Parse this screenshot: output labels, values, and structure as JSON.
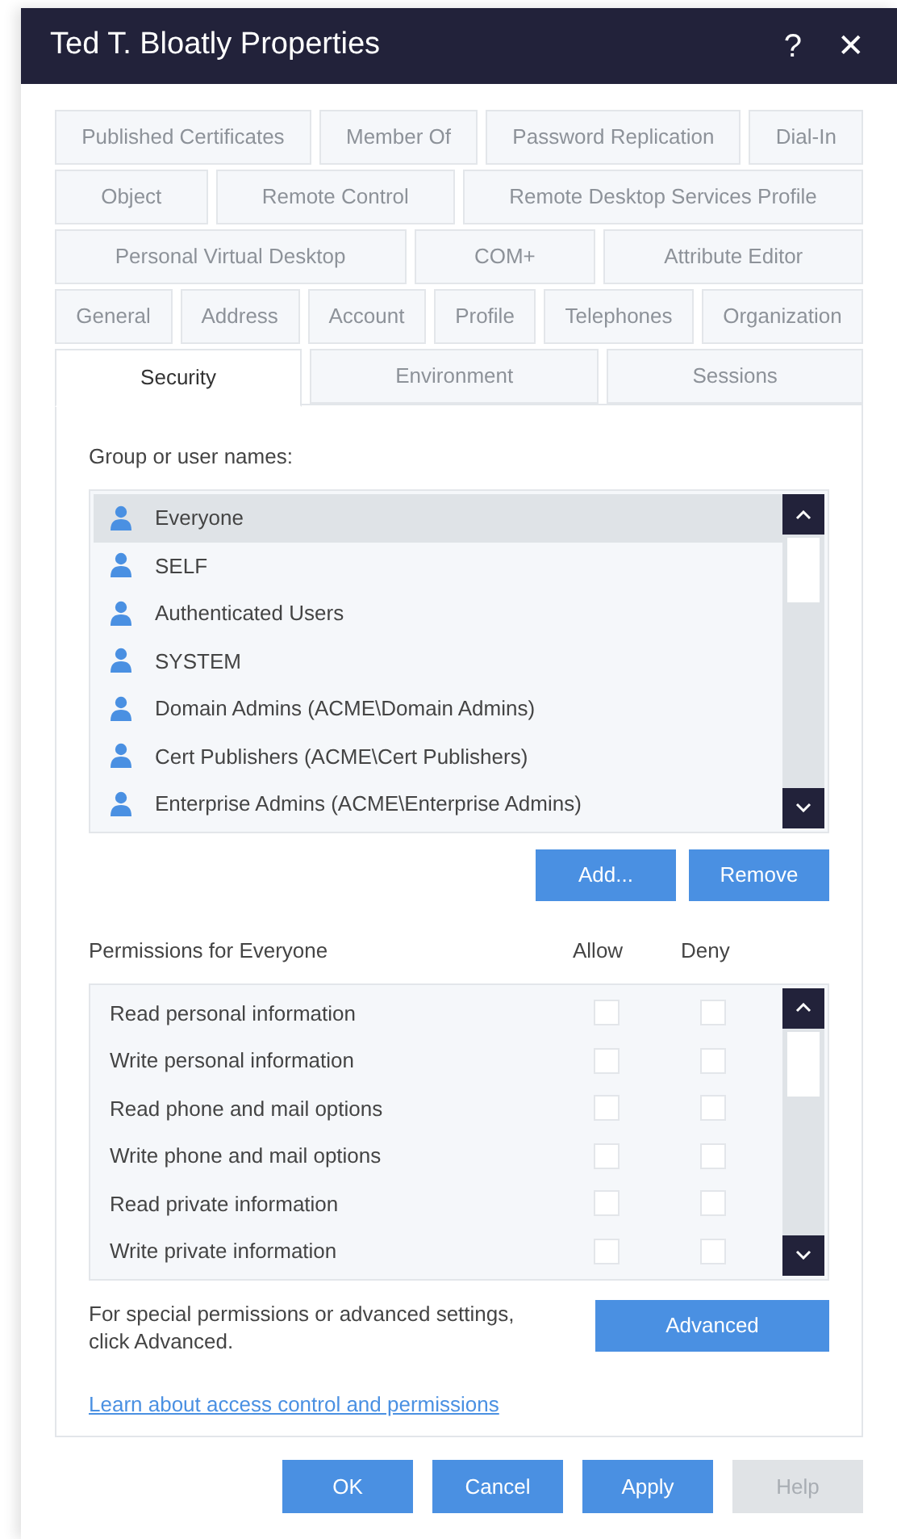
{
  "window": {
    "title": "Ted T. Bloatly Properties",
    "help_glyph": "?",
    "close_glyph": "✕"
  },
  "tab_rows": [
    [
      {
        "label": "Published Certificates",
        "selected": false
      },
      {
        "label": "Member Of",
        "selected": false
      },
      {
        "label": "Password Replication",
        "selected": false
      },
      {
        "label": "Dial-In",
        "selected": false
      }
    ],
    [
      {
        "label": "Object",
        "selected": false
      },
      {
        "label": "Remote Control",
        "selected": false
      },
      {
        "label": "Remote Desktop Services Profile",
        "selected": false
      }
    ],
    [
      {
        "label": "Personal Virtual Desktop",
        "selected": false
      },
      {
        "label": "COM+",
        "selected": false
      },
      {
        "label": "Attribute Editor",
        "selected": false
      }
    ],
    [
      {
        "label": "General",
        "selected": false
      },
      {
        "label": "Address",
        "selected": false
      },
      {
        "label": "Account",
        "selected": false
      },
      {
        "label": "Profile",
        "selected": false
      },
      {
        "label": "Telephones",
        "selected": false
      },
      {
        "label": "Organization",
        "selected": false
      }
    ],
    [
      {
        "label": "Security",
        "selected": true
      },
      {
        "label": "Environment",
        "selected": false
      },
      {
        "label": "Sessions",
        "selected": false
      }
    ]
  ],
  "group_label": "Group or user names:",
  "users": [
    {
      "name": "Everyone",
      "selected": true
    },
    {
      "name": "SELF",
      "selected": false
    },
    {
      "name": "Authenticated Users",
      "selected": false
    },
    {
      "name": "SYSTEM",
      "selected": false
    },
    {
      "name": "Domain Admins (ACME\\Domain Admins)",
      "selected": false
    },
    {
      "name": "Cert Publishers (ACME\\Cert Publishers)",
      "selected": false
    },
    {
      "name": "Enterprise Admins (ACME\\Enterprise Admins)",
      "selected": false
    }
  ],
  "user_buttons": [
    "Add...",
    "Remove"
  ],
  "permissions": {
    "title": "Permissions for Everyone",
    "allow_label": "Allow",
    "deny_label": "Deny",
    "rows": [
      {
        "name": "Read personal information",
        "allow": false,
        "deny": false
      },
      {
        "name": "Write personal information",
        "allow": false,
        "deny": false
      },
      {
        "name": "Read phone and mail options",
        "allow": false,
        "deny": false
      },
      {
        "name": "Write phone and mail options",
        "allow": false,
        "deny": false
      },
      {
        "name": "Read private information",
        "allow": false,
        "deny": false
      },
      {
        "name": "Write private information",
        "allow": false,
        "deny": false
      }
    ]
  },
  "advanced_note": "For special permissions or advanced settings, click Advanced.",
  "advanced_button": "Advanced",
  "link": "Learn about access control and permissions",
  "footer_buttons": [
    {
      "label": "OK",
      "disabled": false
    },
    {
      "label": "Cancel",
      "disabled": false
    },
    {
      "label": "Apply",
      "disabled": false
    },
    {
      "label": "Help",
      "disabled": true
    }
  ]
}
